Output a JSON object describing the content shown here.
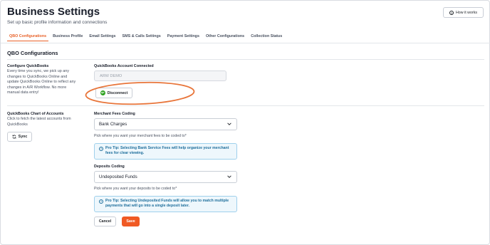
{
  "header": {
    "title": "Business Settings",
    "subtitle": "Set up basic profile information and connections",
    "how_it_works": "How it works"
  },
  "tabs": [
    {
      "label": "QBO Configurations",
      "active": true
    },
    {
      "label": "Business Profile",
      "active": false
    },
    {
      "label": "Email Settings",
      "active": false
    },
    {
      "label": "SMS & Calls Settings",
      "active": false
    },
    {
      "label": "Payment Settings",
      "active": false
    },
    {
      "label": "Other Configurations",
      "active": false
    },
    {
      "label": "Collection Status",
      "active": false
    }
  ],
  "section_title": "QBO Configurations",
  "configure": {
    "heading": "Configure QuickBooks",
    "description": "Every time you sync, we pick up any changes to QuickBooks Online and update QuickBooks Online to reflect any changes in A/R Workflow. No more manual data entry!",
    "account_label": "QuickBooks Account Connected",
    "account_value": "ARW DEMO",
    "disconnect_label": "Disconnect",
    "qb_badge": "qb"
  },
  "chart_of_accounts": {
    "heading": "QuickBooks Chart of Accounts",
    "description": "Click to fetch the latest accounts from QuickBooks",
    "sync_label": "Sync"
  },
  "merchant_fees": {
    "label": "Merchant Fees Coding",
    "selected": "Bank Charges",
    "help": "Pick where you want your merchant fees to be coded to*",
    "tip": "Pro Tip: Selecting Bank Service Fees will help organize your merchant fees for clear viewing."
  },
  "deposits": {
    "label": "Deposits Coding",
    "selected": "Undeposited Funds",
    "help": "Pick where you want your deposits to be coded to*",
    "tip": "Pro Tip: Selecting Undeposited Funds will allow you to match multiple payments that will go into a single deposit later."
  },
  "actions": {
    "cancel": "Cancel",
    "save": "Save"
  },
  "colors": {
    "accent": "#f05a24",
    "tab_active": "#e8622a",
    "tip_bg": "#eef7fc",
    "tip_text": "#1f6f9c",
    "quickbooks_green": "#2ca01c"
  },
  "icons": {
    "help": "question-circle-icon",
    "disconnect": "quickbooks-logo-icon",
    "sync": "sync-icon",
    "select": "chevron-down-icon",
    "tip": "info-icon"
  }
}
